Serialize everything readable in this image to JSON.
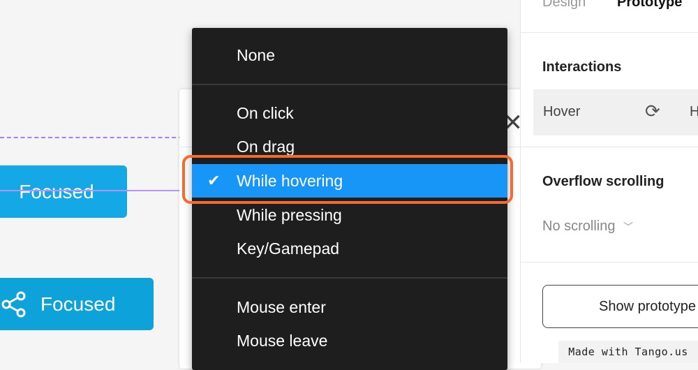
{
  "canvas": {
    "focused_button_1": "Focused",
    "focused_button_2": "Focused"
  },
  "menu": {
    "items": [
      {
        "label": "None",
        "selected": false
      },
      {
        "label": "On click",
        "selected": false
      },
      {
        "label": "On drag",
        "selected": false
      },
      {
        "label": "While hovering",
        "selected": true
      },
      {
        "label": "While pressing",
        "selected": false
      },
      {
        "label": "Key/Gamepad",
        "selected": false
      },
      {
        "label": "Mouse enter",
        "selected": false
      },
      {
        "label": "Mouse leave",
        "selected": false
      }
    ],
    "check_glyph": "✔"
  },
  "right_panel": {
    "tabs": {
      "design": "Design",
      "prototype": "Prototype"
    },
    "interactions_title": "Interactions",
    "interaction_trigger": "Hover",
    "interaction_extra": "H",
    "overflow_title": "Overflow scrolling",
    "overflow_value": "No scrolling",
    "show_prototype_label": "Show prototype"
  },
  "watermark": "Made with Tango.us",
  "colors": {
    "accent_selected": "#1796f7",
    "highlight_outline": "#f46a31",
    "menu_bg": "#1e1e1e",
    "focused_button": "#14a9e6"
  }
}
